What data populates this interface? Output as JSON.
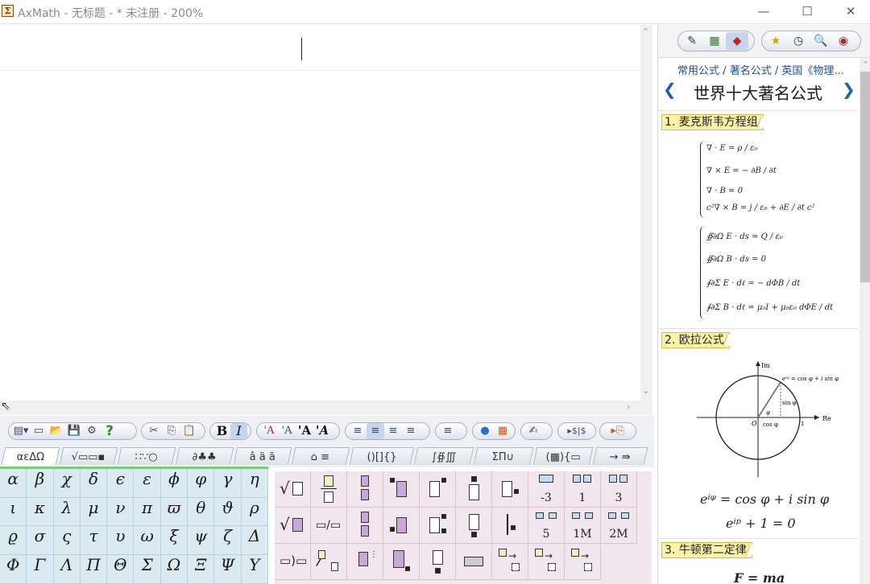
{
  "titlebar": {
    "title": "AxMath - 无标题 - * 未注册 - 200%",
    "minimize": "—",
    "maximize": "☐",
    "close": "✕"
  },
  "toolbar": {
    "groups": [
      [
        "▤▾",
        "▭",
        "📂",
        "💾",
        "⚙",
        "?"
      ],
      [
        "✂",
        "⎘",
        "📋"
      ],
      [
        "B",
        "I"
      ],
      [
        "'A",
        "'A",
        "'A",
        "'A"
      ],
      [
        "≡",
        "≡",
        "≡",
        "≡"
      ],
      [
        "≡"
      ],
      [
        "●",
        "▦"
      ],
      [
        "✍"
      ],
      [
        "▸$|$"
      ],
      [
        "▸⎘"
      ]
    ]
  },
  "symbol_tabs": [
    "αεΔΩ",
    "√▭▭▪",
    "∷∵○",
    "∂♣♣",
    "â ä ã",
    "⌂ ≡",
    "()[]{}",
    "∫∯∭",
    "ΣΠ∪",
    "(▦){▭",
    "→ ⇛"
  ],
  "greek": [
    "α",
    "β",
    "χ",
    "δ",
    "ϵ",
    "ε",
    "ϕ",
    "φ",
    "γ",
    "η",
    "ι",
    "κ",
    "λ",
    "μ",
    "ν",
    "π",
    "ϖ",
    "θ",
    "ϑ",
    "ρ",
    "ϱ",
    "σ",
    "ς",
    "τ",
    "υ",
    "ω",
    "ξ",
    "ψ",
    "ζ",
    "Δ",
    "Φ",
    "Γ",
    "Λ",
    "Π",
    "Θ",
    "Σ",
    "Ω",
    "Ξ",
    "Ψ",
    "Υ"
  ],
  "templates": {
    "labels": [
      "-3",
      "1",
      "3",
      "5",
      "1M",
      "2M"
    ]
  },
  "side": {
    "tool_groups": [
      [
        "✎",
        "▦",
        "◆"
      ],
      [
        "★",
        "◷",
        "🔍",
        "◉"
      ]
    ],
    "breadcrumb": [
      "常用公式",
      "著名公式",
      "英国《物理..."
    ],
    "separator": "/",
    "prev": "❮",
    "next": "❯",
    "title": "世界十大著名公式",
    "sections": [
      "1. 麦克斯韦方程组",
      "2. 欧拉公式",
      "3. 牛顿第二定律"
    ],
    "maxwell": {
      "differential": [
        "∇ · E = ρ / ε₀",
        "∇ × E = − ∂B / ∂t",
        "∇ · B = 0",
        "c²∇ × B = j / ε₀ + ∂E / ∂t c²"
      ],
      "integral": [
        "∯∂Ω E · ds = Q / ε₀",
        "∯∂Ω B · ds = 0",
        "∮∂Σ E · dℓ = − dΦB / dt",
        "∮∂Σ B · dℓ = μ₀I + μ₀ε₀ dΦE / dt"
      ]
    },
    "euler": {
      "im_label": "Im",
      "re_label": "Re",
      "eq_label": "eⁱᵠ = cos φ + i sin φ",
      "sin_label": "sin φ",
      "cos_label": "cos φ",
      "phi": "φ",
      "origin": "O",
      "one": "1",
      "formula1": "eⁱᵠ = cos φ + i sin φ",
      "formula2": "eⁱᵖ + 1 = 0"
    },
    "newton": {
      "formula": "F = ma"
    }
  }
}
